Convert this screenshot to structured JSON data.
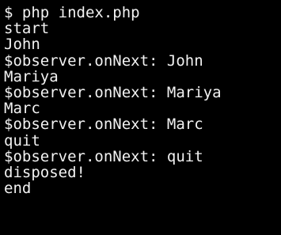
{
  "terminal": {
    "foreground": "#f2f2f2",
    "background": "#000000",
    "lines": [
      "$ php index.php",
      "start",
      "John",
      "$observer.onNext: John",
      "Mariya",
      "$observer.onNext: Mariya",
      "Marc",
      "$observer.onNext: Marc",
      "quit",
      "$observer.onNext: quit",
      "disposed!",
      "end"
    ]
  }
}
